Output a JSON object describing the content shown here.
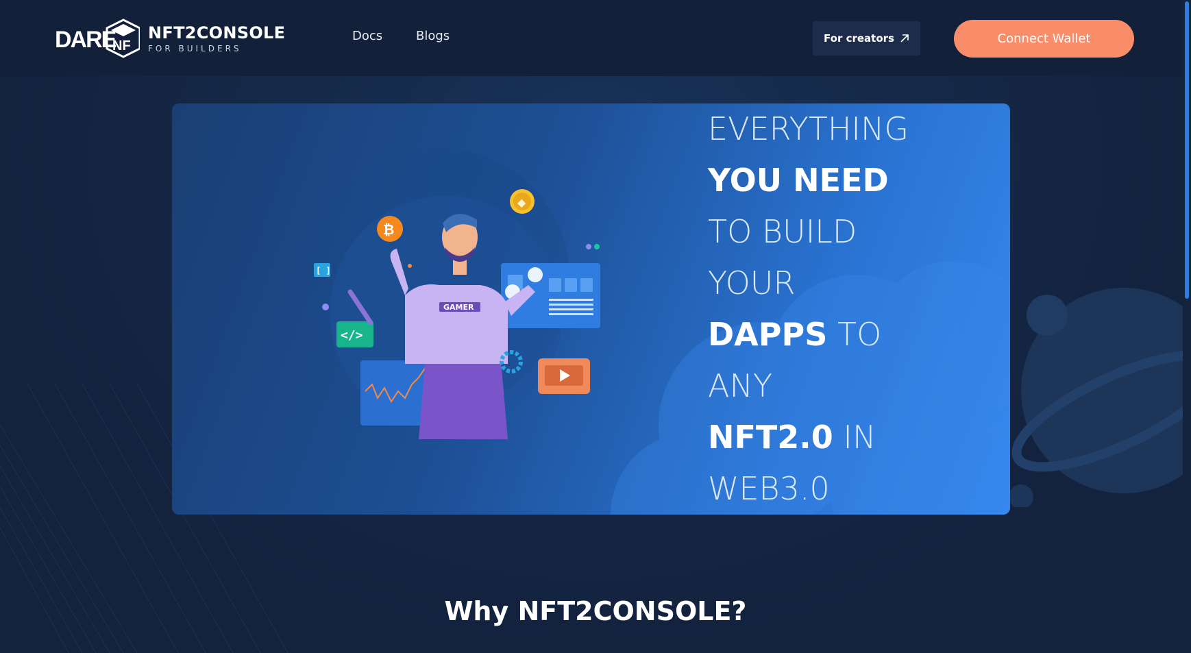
{
  "header": {
    "logo_word": "DARE",
    "logo_badge": "NF",
    "logo_title": "NFT2CONSOLE",
    "logo_subtitle": "FOR BUILDERS",
    "nav": [
      {
        "label": "Docs"
      },
      {
        "label": "Blogs"
      }
    ],
    "creators_label": "For creators",
    "connect_label": "Connect Wallet"
  },
  "hero": {
    "lines": [
      {
        "thin1": "EVERYTHING",
        "bold": "",
        "thin2": ""
      },
      {
        "thin1": "",
        "bold": "YOU NEED",
        "thin2": ""
      },
      {
        "thin1": "TO BUILD",
        "bold": "",
        "thin2": ""
      },
      {
        "thin1": "YOUR",
        "bold": "",
        "thin2": ""
      },
      {
        "thin1": "",
        "bold": "DAPPS",
        "thin2": " TO"
      },
      {
        "thin1": "ANY",
        "bold": "",
        "thin2": ""
      },
      {
        "thin1": "",
        "bold": "NFT2.0",
        "thin2": " IN"
      },
      {
        "thin1": "WEB3.0",
        "bold": "",
        "thin2": ""
      }
    ],
    "illustration": {
      "shirt_text": "GAMER",
      "code_badge": "</>",
      "bracket_badge": "[ ]",
      "coin_btc": "₿",
      "coin_eth": "◆"
    }
  },
  "section": {
    "why_title": "Why NFT2CONSOLE?"
  },
  "colors": {
    "background": "#13223d",
    "accent": "#f98d6a",
    "hero_start": "#1a3f74",
    "hero_end": "#3689ee"
  },
  "icons": [
    "dare-logo-icon",
    "arrow-up-right-icon",
    "bitcoin-icon",
    "ethereum-icon",
    "code-icon",
    "play-icon",
    "gear-icon",
    "wrench-icon"
  ]
}
